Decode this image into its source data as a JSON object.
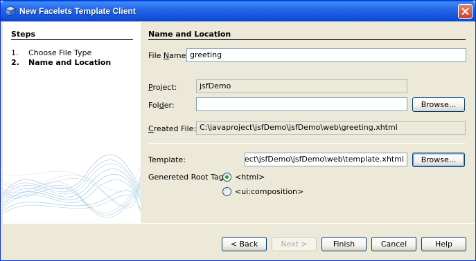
{
  "window": {
    "title": "New Facelets Template Client",
    "icon": "cube-icon"
  },
  "steps": {
    "header": "Steps",
    "items": [
      {
        "num": "1.",
        "label": "Choose File Type",
        "active": false
      },
      {
        "num": "2.",
        "label": "Name and Location",
        "active": true
      }
    ]
  },
  "form": {
    "section_title": "Name and Location",
    "file_name": {
      "label_pre": "File ",
      "label_mn": "N",
      "label_post": "ame:",
      "value": "greeting"
    },
    "project": {
      "label_mn": "P",
      "label_post": "roject:",
      "value": "jsfDemo"
    },
    "folder": {
      "label_pre": "Fol",
      "label_mn": "d",
      "label_post": "er:",
      "value": "",
      "browse": "Browse..."
    },
    "created_file": {
      "label_mn": "C",
      "label_post": "reated File:",
      "value": "C:\\javaproject\\jsfDemo\\jsfDemo\\web\\greeting.xhtml"
    },
    "template": {
      "label": "Template:",
      "value": "C:\\javaproject\\jsfDemo\\jsfDemo\\web\\template.xhtml",
      "browse": "Browse..."
    },
    "root_tag": {
      "label": "Genereted Root Tag:",
      "options": [
        {
          "label": "<html>",
          "selected": true
        },
        {
          "label": "<ui:composition>",
          "selected": false
        }
      ]
    }
  },
  "buttons": {
    "back": "< Back",
    "next": "Next >",
    "finish": "Finish",
    "cancel": "Cancel",
    "help": "Help"
  },
  "colors": {
    "titlebar": "#0A5FEA",
    "dialog_bg": "#ECE9D8",
    "radio_selected": "#21A121"
  }
}
